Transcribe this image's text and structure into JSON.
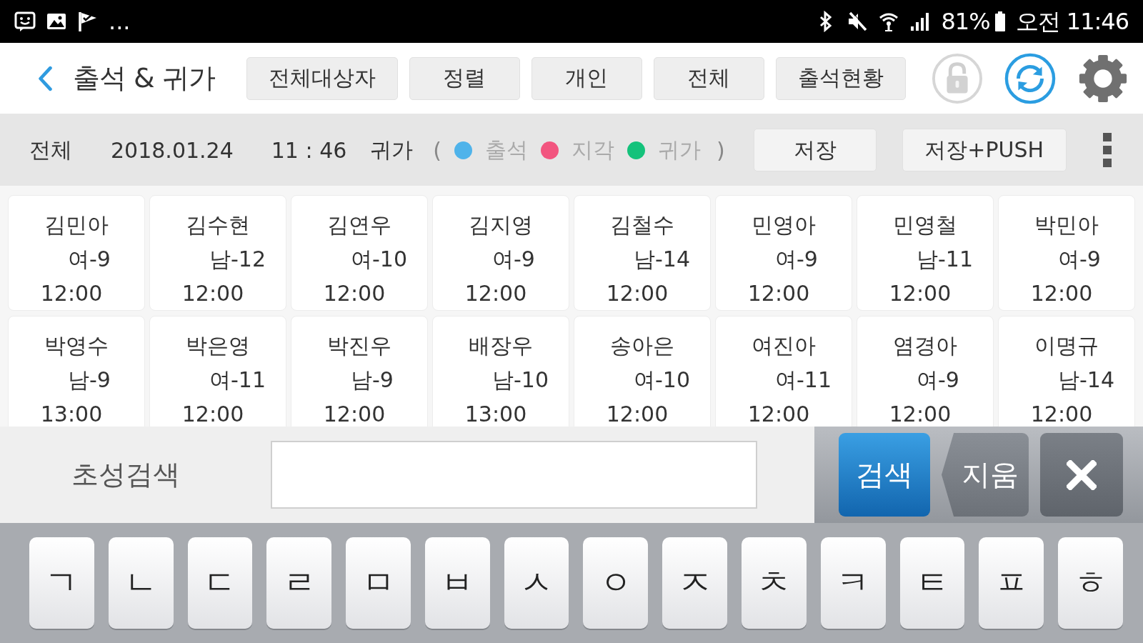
{
  "status_bar": {
    "overflow": "...",
    "battery": "81%",
    "clock": "오전 11:46"
  },
  "header": {
    "title": "출석 & 귀가",
    "buttons": [
      "전체대상자",
      "정렬",
      "개인",
      "전체",
      "출석현황"
    ]
  },
  "filter_bar": {
    "scope": "전체",
    "date": "2018.01.24",
    "time": "11 : 46",
    "mode": "귀가",
    "open_paren": "(",
    "legend": [
      {
        "label": "출석",
        "color": "#4fb3ea"
      },
      {
        "label": "지각",
        "color": "#f2557f"
      },
      {
        "label": "귀가",
        "color": "#14c27b"
      }
    ],
    "close_paren": ")",
    "buttons": [
      "저장",
      "저장+PUSH"
    ]
  },
  "students": [
    {
      "name": "김민아",
      "info": "여-9",
      "time": "12:00"
    },
    {
      "name": "김수현",
      "info": "남-12",
      "time": "12:00"
    },
    {
      "name": "김연우",
      "info": "여-10",
      "time": "12:00"
    },
    {
      "name": "김지영",
      "info": "여-9",
      "time": "12:00"
    },
    {
      "name": "김철수",
      "info": "남-14",
      "time": "12:00"
    },
    {
      "name": "민영아",
      "info": "여-9",
      "time": "12:00"
    },
    {
      "name": "민영철",
      "info": "남-11",
      "time": "12:00"
    },
    {
      "name": "박민아",
      "info": "여-9",
      "time": "12:00"
    },
    {
      "name": "박영수",
      "info": "남-9",
      "time": "13:00"
    },
    {
      "name": "박은영",
      "info": "여-11",
      "time": "12:00"
    },
    {
      "name": "박진우",
      "info": "남-9",
      "time": "12:00"
    },
    {
      "name": "배장우",
      "info": "남-10",
      "time": "13:00"
    },
    {
      "name": "송아은",
      "info": "여-10",
      "time": "12:00"
    },
    {
      "name": "여진아",
      "info": "여-11",
      "time": "12:00"
    },
    {
      "name": "염경아",
      "info": "여-9",
      "time": "12:00"
    },
    {
      "name": "이명규",
      "info": "남-14",
      "time": "12:00"
    }
  ],
  "search": {
    "label": "초성검색",
    "search_button": "검색",
    "clear_button": "지움"
  },
  "keyboard": {
    "keys": [
      "ㄱ",
      "ㄴ",
      "ㄷ",
      "ㄹ",
      "ㅁ",
      "ㅂ",
      "ㅅ",
      "ㅇ",
      "ㅈ",
      "ㅊ",
      "ㅋ",
      "ㅌ",
      "ㅍ",
      "ㅎ"
    ]
  }
}
